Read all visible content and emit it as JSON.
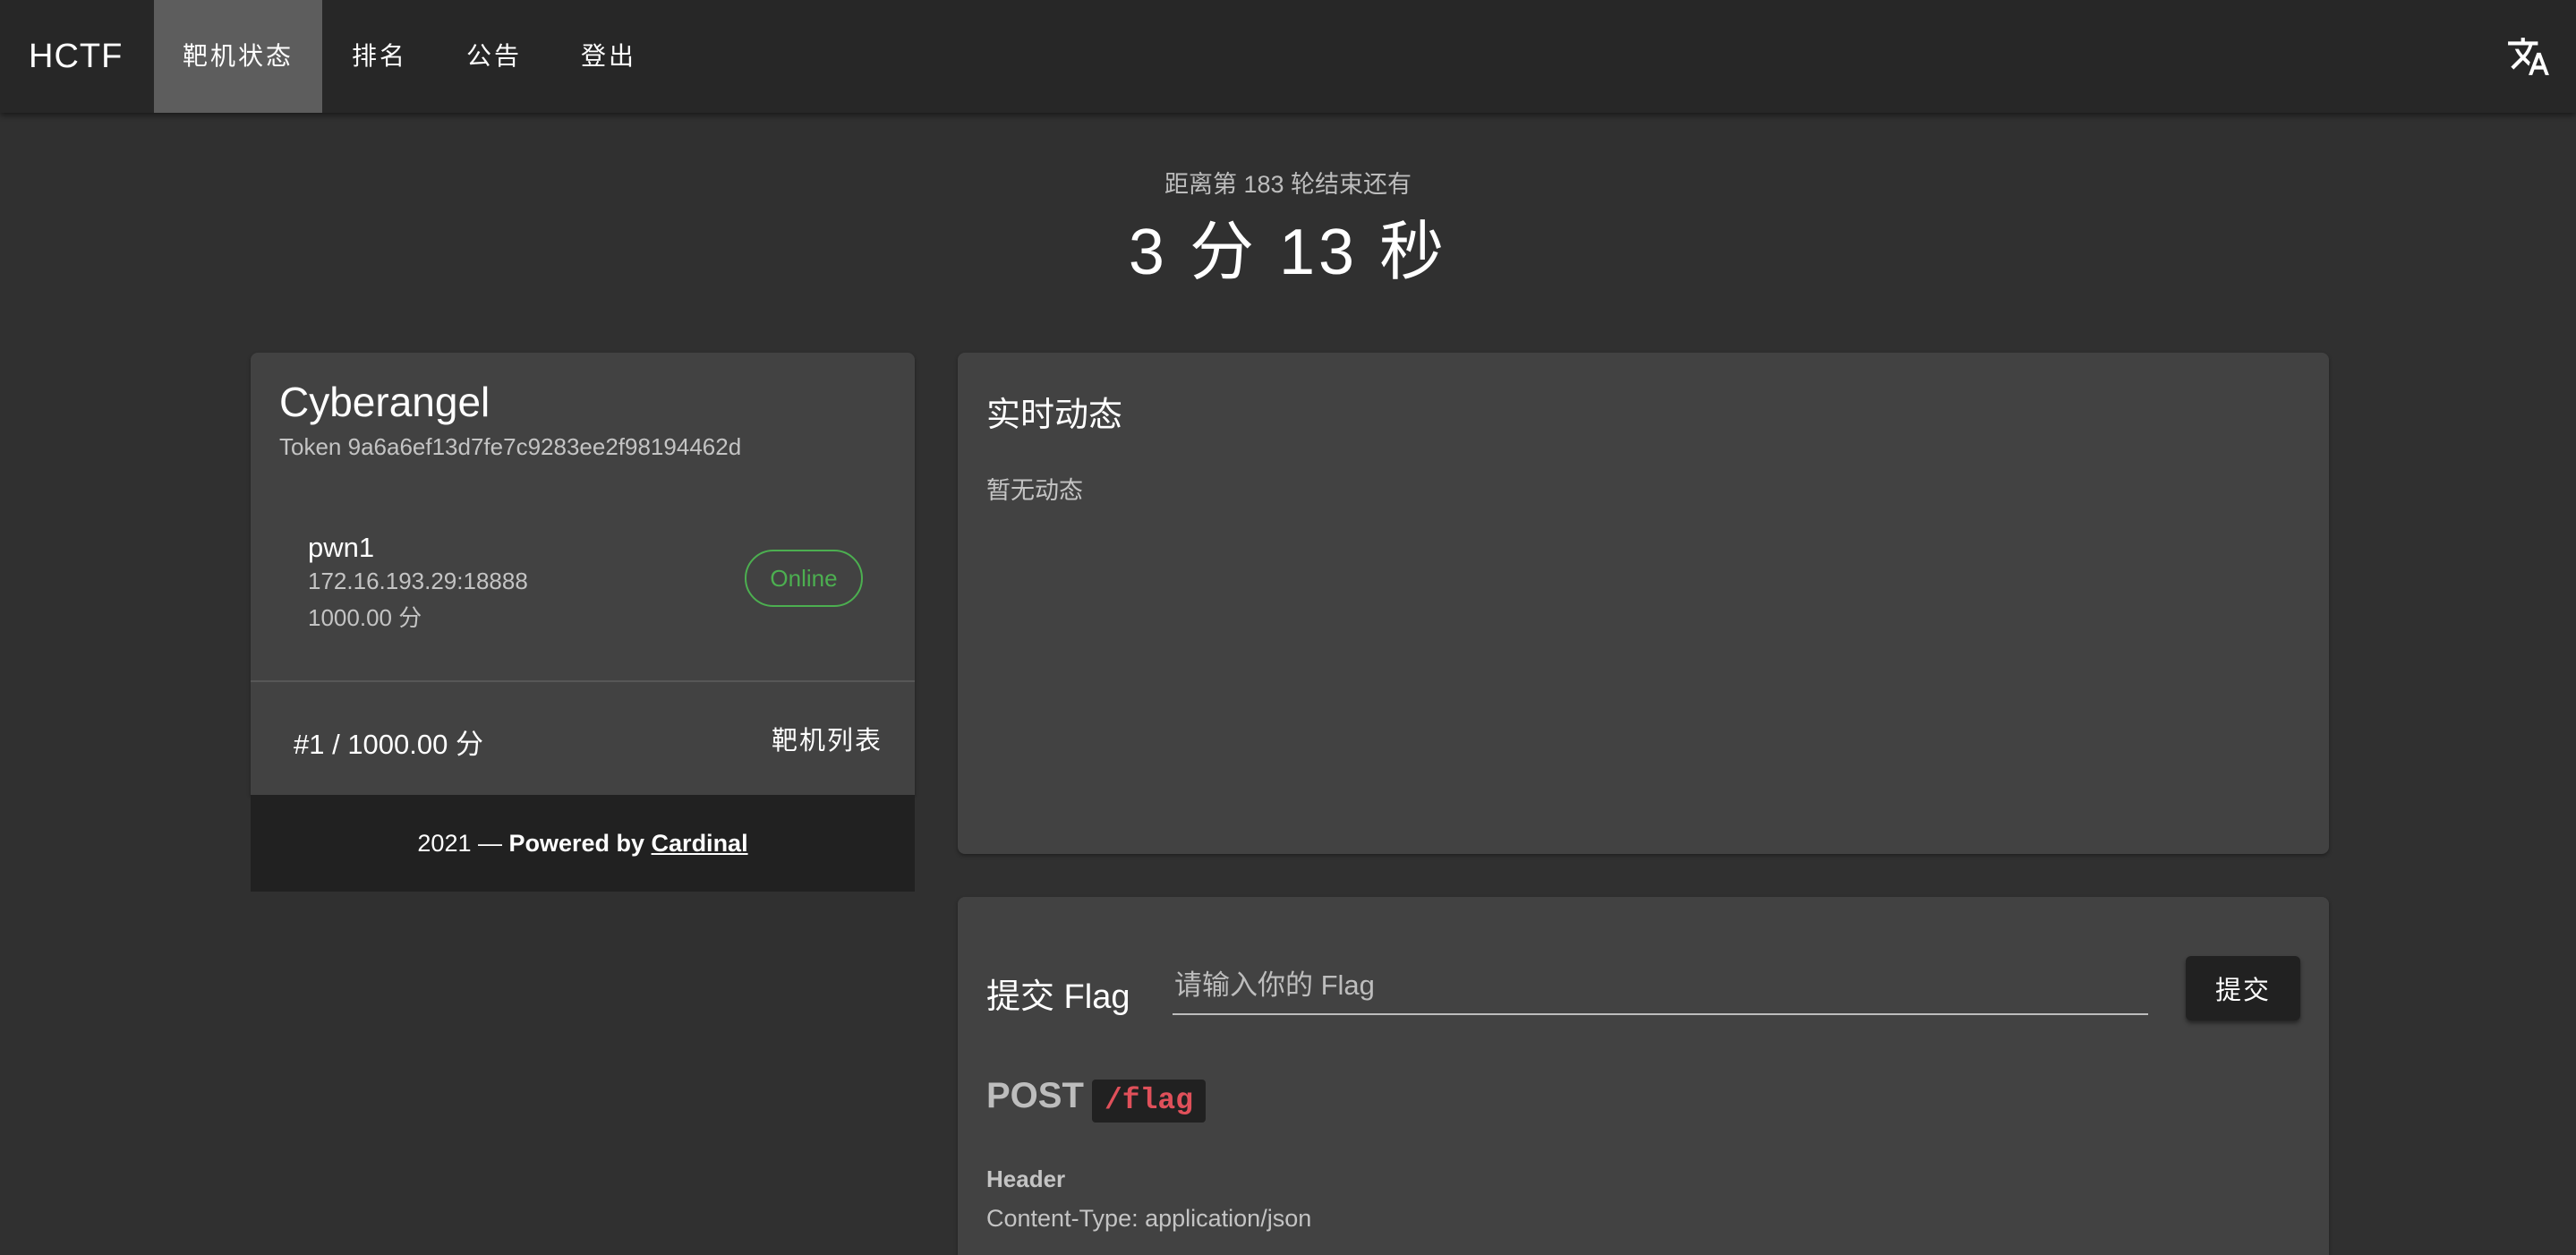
{
  "appbar": {
    "brand": "HCTF",
    "tabs": [
      {
        "label": "靶机状态",
        "active": true
      },
      {
        "label": "排名",
        "active": false
      },
      {
        "label": "公告",
        "active": false
      },
      {
        "label": "登出",
        "active": false
      }
    ],
    "translate_icon": "translate-icon"
  },
  "countdown": {
    "caption": "距离第 183 轮结束还有",
    "timer": "3 分 13 秒"
  },
  "team": {
    "name": "Cyberangel",
    "token": "Token 9a6a6ef13d7fe7c9283ee2f98194462d",
    "target": {
      "name": "pwn1",
      "address": "172.16.193.29:18888",
      "score": "1000.00 分",
      "status": "Online",
      "status_color": "#4caf50"
    },
    "rank": "#1 / 1000.00 分",
    "target_list_label": "靶机列表"
  },
  "footer": {
    "year": "2021",
    "separator": " — ",
    "powered_by": "Powered by ",
    "link": "Cardinal"
  },
  "live": {
    "title": "实时动态",
    "empty": "暂无动态"
  },
  "flag": {
    "title": "提交 Flag",
    "input_placeholder": "请输入你的 Flag",
    "input_value": "",
    "submit_label": "提交",
    "method": "POST",
    "path": "/flag",
    "path_color": "#e0505a",
    "header_label": "Header",
    "header_value": "Content-Type: application/json"
  }
}
